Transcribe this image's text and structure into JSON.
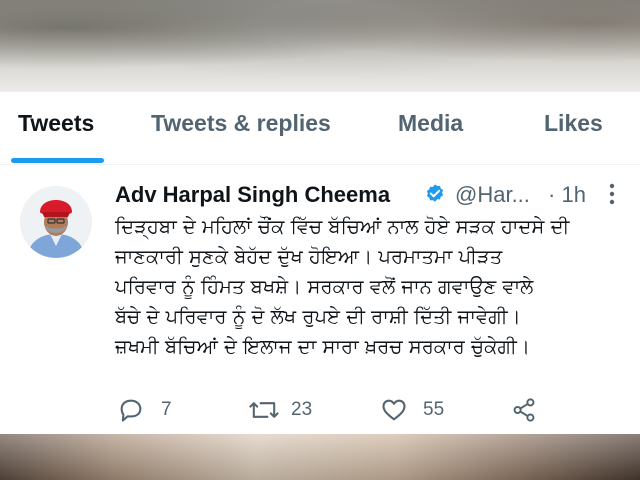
{
  "tabs": {
    "items": [
      {
        "label": "Tweets"
      },
      {
        "label": "Tweets & replies"
      },
      {
        "label": "Media"
      },
      {
        "label": "Likes"
      }
    ],
    "active_index": 0
  },
  "tweet": {
    "author_name": "Adv Harpal Singh Cheema",
    "handle": "@Har...",
    "separator": "·",
    "time": "1h",
    "text_lines": [
      "ਦਿੜ੍ਹਬਾ ਦੇ ਮਹਿਲਾਂ ਚੌਂਕ ਵਿੱਚ ਬੱਚਿਆਂ ਨਾਲ ਹੋਏ ਸੜਕ ਹਾਦਸੇ ਦੀ",
      "ਜਾਣਕਾਰੀ ਸੁਣਕੇ ਬੇਹੱਦ ਦੁੱਖ ਹੋਇਆ। ਪਰਮਾਤਮਾ ਪੀੜਤ",
      "ਪਰਿਵਾਰ ਨੂੰ ਹਿੰਮਤ ਬਖਸ਼ੇ। ਸਰਕਾਰ ਵਲੋਂ ਜਾਨ ਗਵਾਉਣ ਵਾਲੇ",
      "ਬੱਚੇ ਦੇ ਪਰਿਵਾਰ ਨੂੰ ਦੋ ਲੱਖ ਰੁਪਏ ਦੀ ਰਾਸ਼ੀ ਦਿੱਤੀ ਜਾਵੇਗੀ।",
      "ਜ਼ਖਮੀ ਬੱਚਿਆਂ ਦੇ ਇਲਾਜ ਦਾ ਸਾਰਾ ਖ਼ਰਚ ਸਰਕਾਰ ਚੁੱਕੇਗੀ।"
    ],
    "replies": "7",
    "retweets": "23",
    "likes": "55",
    "icons": {
      "reply": "reply-icon",
      "retweet": "retweet-icon",
      "like": "heart-icon",
      "share": "share-icon",
      "verified": "verified-badge-icon",
      "more": "more-icon"
    }
  },
  "colors": {
    "accent": "#1d9bf0",
    "text_primary": "#0f1419",
    "text_secondary": "#536471"
  }
}
